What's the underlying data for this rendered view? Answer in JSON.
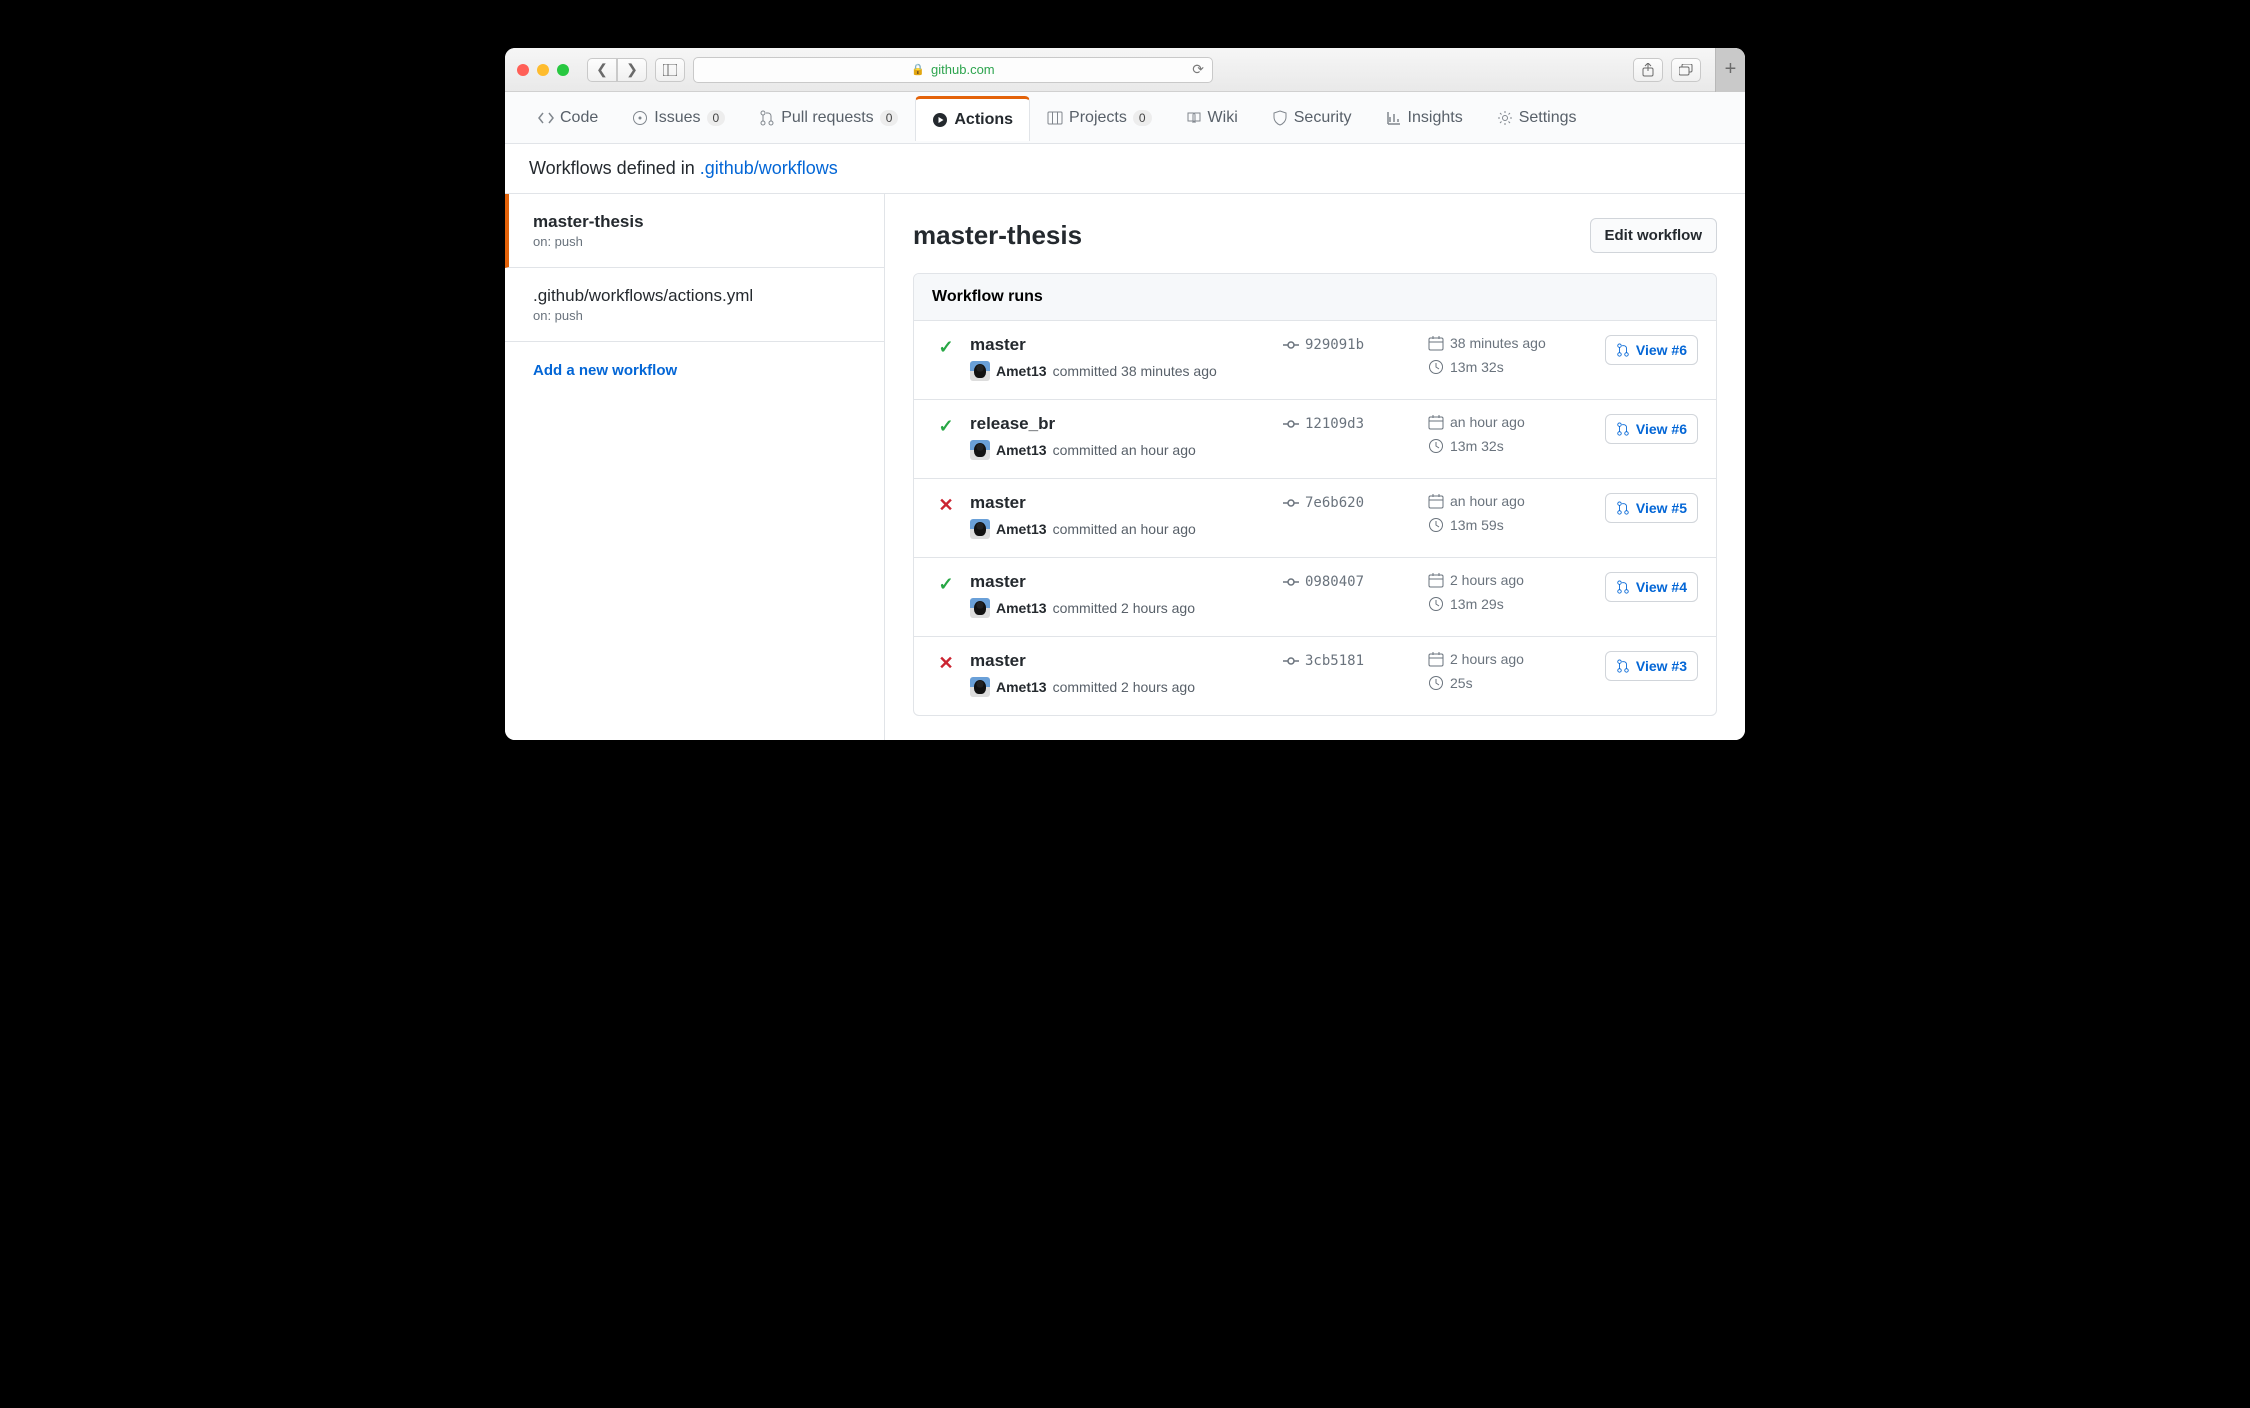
{
  "browser": {
    "host": "github.com"
  },
  "tabs": {
    "code": "Code",
    "issues": "Issues",
    "issues_count": "0",
    "pulls": "Pull requests",
    "pulls_count": "0",
    "actions": "Actions",
    "projects": "Projects",
    "projects_count": "0",
    "wiki": "Wiki",
    "security": "Security",
    "insights": "Insights",
    "settings": "Settings"
  },
  "breadcrumb": {
    "prefix": "Workflows defined in ",
    "path": ".github/workflows"
  },
  "sidebar": {
    "items": [
      {
        "title": "master-thesis",
        "sub": "on: push",
        "selected": true
      },
      {
        "title": ".github/workflows/actions.yml",
        "sub": "on: push",
        "selected": false
      }
    ],
    "add_label": "Add a new workflow"
  },
  "main": {
    "title": "master-thesis",
    "edit_label": "Edit workflow",
    "runs_header": "Workflow runs",
    "committed_word": "committed"
  },
  "runs": [
    {
      "status": "success",
      "branch": "master",
      "author": "Amet13",
      "committed_ago": "38 minutes ago",
      "sha": "929091b",
      "queued_ago": "38 minutes ago",
      "duration": "13m 32s",
      "view_label": "View #6"
    },
    {
      "status": "success",
      "branch": "release_br",
      "author": "Amet13",
      "committed_ago": "an hour ago",
      "sha": "12109d3",
      "queued_ago": "an hour ago",
      "duration": "13m 32s",
      "view_label": "View #6"
    },
    {
      "status": "failure",
      "branch": "master",
      "author": "Amet13",
      "committed_ago": "an hour ago",
      "sha": "7e6b620",
      "queued_ago": "an hour ago",
      "duration": "13m 59s",
      "view_label": "View #5"
    },
    {
      "status": "success",
      "branch": "master",
      "author": "Amet13",
      "committed_ago": "2 hours ago",
      "sha": "0980407",
      "queued_ago": "2 hours ago",
      "duration": "13m 29s",
      "view_label": "View #4"
    },
    {
      "status": "failure",
      "branch": "master",
      "author": "Amet13",
      "committed_ago": "2 hours ago",
      "sha": "3cb5181",
      "queued_ago": "2 hours ago",
      "duration": "25s",
      "view_label": "View #3"
    }
  ]
}
